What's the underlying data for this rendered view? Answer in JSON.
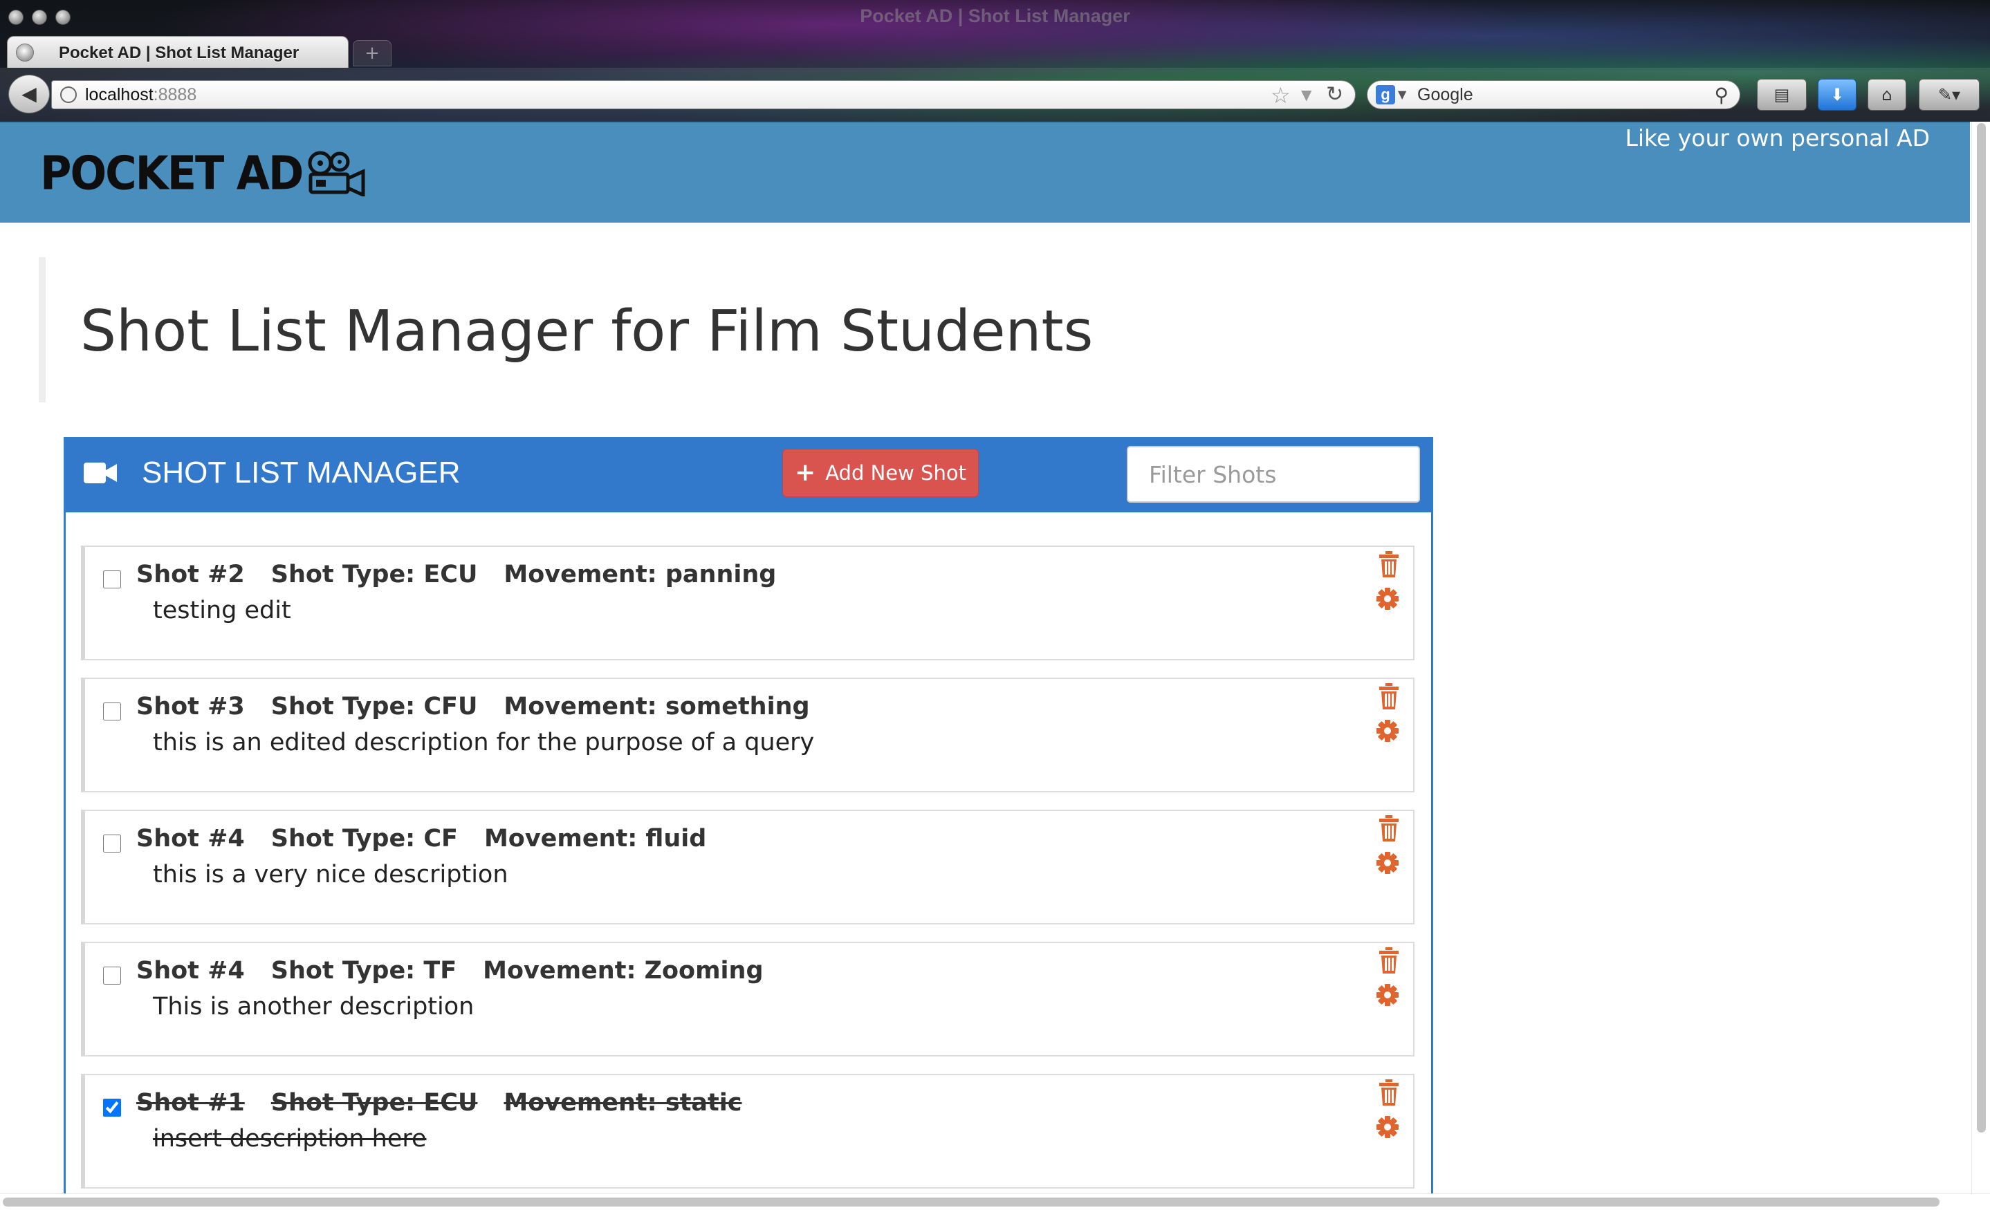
{
  "window": {
    "title": "Pocket AD | Shot List Manager",
    "tab_title": "Pocket AD | Shot List Manager"
  },
  "browser": {
    "url_host": "localhost",
    "url_port": ":8888",
    "search_placeholder": "Google"
  },
  "header": {
    "logo": "POCKET AD",
    "tagline": "Like your own personal AD"
  },
  "page_title": "Shot List Manager for Film Students",
  "panel": {
    "title": "SHOT LIST MANAGER",
    "add_button": "Add New Shot",
    "filter_placeholder": "Filter Shots"
  },
  "shots": [
    {
      "shot": "Shot #2",
      "type": "Shot Type: ECU",
      "movement": "Movement: panning",
      "description": "testing edit",
      "done": false
    },
    {
      "shot": "Shot #3",
      "type": "Shot Type: CFU",
      "movement": "Movement: something",
      "description": "this is an edited description for the purpose of a query",
      "done": false
    },
    {
      "shot": "Shot #4",
      "type": "Shot Type: CF",
      "movement": "Movement: fluid",
      "description": "this is a very nice description",
      "done": false
    },
    {
      "shot": "Shot #4",
      "type": "Shot Type: TF",
      "movement": "Movement: Zooming",
      "description": "This is another description",
      "done": false
    },
    {
      "shot": "Shot #1",
      "type": "Shot Type: ECU",
      "movement": "Movement: static",
      "description": "insert description here",
      "done": true
    }
  ],
  "colors": {
    "header_bg": "#4a8ebd",
    "panel_heading_bg": "#3279cc",
    "add_button_bg": "#d9534f",
    "action_icon": "#e0642e"
  },
  "icons": {
    "logo": "film-camera-icon",
    "panel": "video-camera-icon",
    "add": "plus-icon",
    "delete": "trash-icon",
    "edit": "gear-icon"
  }
}
